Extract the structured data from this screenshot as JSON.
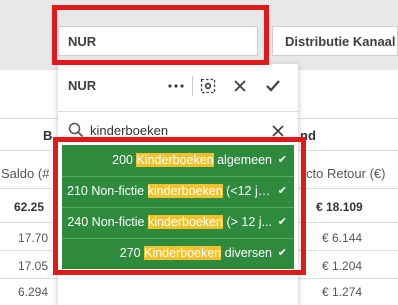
{
  "filters": {
    "nur_label": "NUR",
    "distributie_label": "Distributie Kanaal"
  },
  "table": {
    "col_saldo": "Saldo (#",
    "col_retour": "cto Retour (€)",
    "header_b": "B",
    "header_nd": "nd",
    "left_values": [
      "62.25",
      "17.70",
      "17.05",
      "6.294"
    ],
    "right_values": [
      "€ 18.109",
      "€ 6.144",
      "€ 1.204",
      "€ 1.274"
    ]
  },
  "popover": {
    "title": "NUR",
    "search_value": "kinderboeken",
    "items": [
      {
        "pre": "200 ",
        "hl": "Kinderboeken",
        "post": " algemeen"
      },
      {
        "pre": "210 Non-fictie ",
        "hl": "kinderboeken",
        "post": " (<12 ja..."
      },
      {
        "pre": "240 Non-fictie ",
        "hl": "kinderboeken",
        "post": " (> 12 j..."
      },
      {
        "pre": "270 ",
        "hl": "Kinderboeken",
        "post": " diversen"
      }
    ]
  },
  "colors": {
    "selected_green": "#2e8b3e",
    "highlight_yellow": "#f3c22b",
    "annotation_red": "#e01a1a"
  },
  "icons": [
    "more-options-icon",
    "clear-selection-icon",
    "cancel-icon",
    "confirm-icon",
    "search-icon",
    "clear-search-icon",
    "check-icon"
  ]
}
